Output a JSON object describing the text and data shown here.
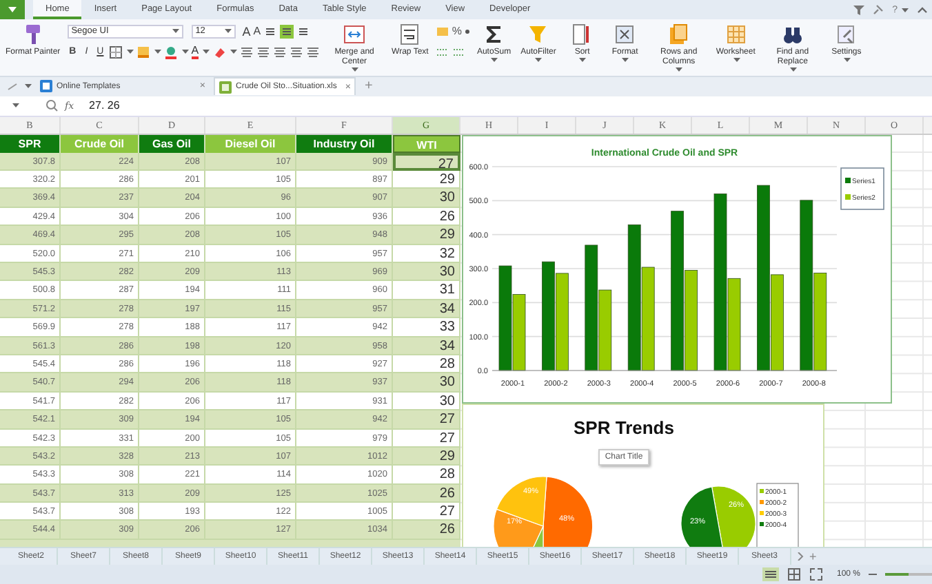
{
  "menu_tabs": [
    {
      "label": "Home",
      "selected": true
    },
    {
      "label": "Insert",
      "selected": false
    },
    {
      "label": "Page Layout",
      "selected": false
    },
    {
      "label": "Formulas",
      "selected": false
    },
    {
      "label": "Data",
      "selected": false
    },
    {
      "label": "Table Style",
      "selected": false
    },
    {
      "label": "Review",
      "selected": false
    },
    {
      "label": "View",
      "selected": false
    },
    {
      "label": "Developer",
      "selected": false
    }
  ],
  "help": "?",
  "ribbon": {
    "format_painter": "Format Painter",
    "font_name": "Segoe UI",
    "font_size": "12",
    "size_keys": [
      "A",
      "A"
    ],
    "style_keys": [
      "B",
      "I",
      "U"
    ],
    "font_color_key": "A",
    "percent": "%",
    "buttons": [
      {
        "label": "Merge and Center",
        "dropdown": true
      },
      {
        "label": "Wrap Text",
        "dropdown": false
      },
      {
        "label": "AutoSum",
        "dropdown": true
      },
      {
        "label": "AutoFilter",
        "dropdown": true
      },
      {
        "label": "Sort",
        "dropdown": true
      },
      {
        "label": "Format",
        "dropdown": true
      },
      {
        "label": "Rows and Columns",
        "dropdown": true
      },
      {
        "label": "Worksheet",
        "dropdown": true
      },
      {
        "label": "Find and Replace",
        "dropdown": true
      },
      {
        "label": "Settings",
        "dropdown": true
      }
    ]
  },
  "doc_tabs": [
    {
      "label": "Online Templates",
      "selected": false,
      "close": "×"
    },
    {
      "label": "Crude Oil Sto...Situation.xls",
      "selected": true,
      "close": "×"
    }
  ],
  "new_tab": "+",
  "formula_bar": {
    "fx": "fx",
    "value": "27. 26"
  },
  "column_letters": [
    {
      "label": "B",
      "selected": false
    },
    {
      "label": "C",
      "selected": false
    },
    {
      "label": "D",
      "selected": false
    },
    {
      "label": "E",
      "selected": false
    },
    {
      "label": "F",
      "selected": false
    },
    {
      "label": "G",
      "selected": true
    },
    {
      "label": "H",
      "selected": false
    },
    {
      "label": "I",
      "selected": false
    },
    {
      "label": "J",
      "selected": false
    },
    {
      "label": "K",
      "selected": false
    },
    {
      "label": "L",
      "selected": false
    },
    {
      "label": "M",
      "selected": false
    },
    {
      "label": "N",
      "selected": false
    },
    {
      "label": "O",
      "selected": false
    }
  ],
  "table": {
    "columns": [
      {
        "label": "SPR",
        "color": "#107c10",
        "selected": false
      },
      {
        "label": "Crude Oil",
        "color": "#8cc63e",
        "selected": false
      },
      {
        "label": "Gas Oil",
        "color": "#107c10",
        "selected": false
      },
      {
        "label": "Diesel Oil",
        "color": "#8cc63e",
        "selected": false
      },
      {
        "label": "Industry Oil",
        "color": "#107c10",
        "selected": false
      },
      {
        "label": "WTI",
        "color": "#8cc63e",
        "selected": true
      }
    ],
    "rows": [
      {
        "selected": true,
        "cells": [
          "307.8",
          "224",
          "208",
          "107",
          "909",
          "27"
        ]
      },
      {
        "selected": false,
        "cells": [
          "320.2",
          "286",
          "201",
          "105",
          "897",
          "29"
        ]
      },
      {
        "selected": false,
        "cells": [
          "369.4",
          "237",
          "204",
          "96",
          "907",
          "30"
        ]
      },
      {
        "selected": false,
        "cells": [
          "429.4",
          "304",
          "206",
          "100",
          "936",
          "26"
        ]
      },
      {
        "selected": false,
        "cells": [
          "469.4",
          "295",
          "208",
          "105",
          "948",
          "29"
        ]
      },
      {
        "selected": false,
        "cells": [
          "520.0",
          "271",
          "210",
          "106",
          "957",
          "32"
        ]
      },
      {
        "selected": false,
        "cells": [
          "545.3",
          "282",
          "209",
          "113",
          "969",
          "30"
        ]
      },
      {
        "selected": false,
        "cells": [
          "500.8",
          "287",
          "194",
          "111",
          "960",
          "31"
        ]
      },
      {
        "selected": false,
        "cells": [
          "571.2",
          "278",
          "197",
          "115",
          "957",
          "34"
        ]
      },
      {
        "selected": false,
        "cells": [
          "569.9",
          "278",
          "188",
          "117",
          "942",
          "33"
        ]
      },
      {
        "selected": false,
        "cells": [
          "561.3",
          "286",
          "198",
          "120",
          "958",
          "34"
        ]
      },
      {
        "selected": false,
        "cells": [
          "545.4",
          "286",
          "196",
          "118",
          "927",
          "28"
        ]
      },
      {
        "selected": false,
        "cells": [
          "540.7",
          "294",
          "206",
          "118",
          "937",
          "30"
        ]
      },
      {
        "selected": false,
        "cells": [
          "541.7",
          "282",
          "206",
          "117",
          "931",
          "30"
        ]
      },
      {
        "selected": false,
        "cells": [
          "542.1",
          "309",
          "194",
          "105",
          "942",
          "27"
        ]
      },
      {
        "selected": false,
        "cells": [
          "542.3",
          "331",
          "200",
          "105",
          "979",
          "27"
        ]
      },
      {
        "selected": false,
        "cells": [
          "543.2",
          "328",
          "213",
          "107",
          "1012",
          "29"
        ]
      },
      {
        "selected": false,
        "cells": [
          "543.3",
          "308",
          "221",
          "114",
          "1020",
          "28"
        ]
      },
      {
        "selected": false,
        "cells": [
          "543.7",
          "313",
          "209",
          "125",
          "1025",
          "26"
        ]
      },
      {
        "selected": false,
        "cells": [
          "543.7",
          "308",
          "193",
          "122",
          "1005",
          "27"
        ]
      },
      {
        "selected": false,
        "cells": [
          "544.4",
          "309",
          "206",
          "127",
          "1034",
          "26"
        ]
      }
    ]
  },
  "bar_chart": {
    "chart_data": {
      "type": "bar",
      "title": "International Crude Oil and SPR",
      "categories": [
        "2000-1",
        "2000-2",
        "2000-3",
        "2000-4",
        "2000-5",
        "2000-6",
        "2000-7",
        "2000-8"
      ],
      "series": [
        {
          "name": "Series1",
          "color": "#0a7a0a",
          "values": [
            308,
            320,
            369,
            429,
            469,
            520,
            545,
            501
          ]
        },
        {
          "name": "Series2",
          "color": "#99cc00",
          "values": [
            224,
            286,
            237,
            304,
            295,
            271,
            282,
            287
          ]
        }
      ],
      "ylim": [
        0,
        600
      ],
      "grid": true,
      "legend": true,
      "yticks": [
        {
          "value": 0,
          "label": "0.0"
        },
        {
          "value": 100,
          "label": "100.0"
        },
        {
          "value": 200,
          "label": "200.0"
        },
        {
          "value": 300,
          "label": "300.0"
        },
        {
          "value": 400,
          "label": "400.0"
        },
        {
          "value": 500,
          "label": "500.0"
        },
        {
          "value": 600,
          "label": "600.0"
        }
      ]
    }
  },
  "pie_panel": {
    "title": "SPR Trends",
    "chart_title": "Chart Title",
    "pies": [
      {
        "labels": [
          "49%",
          "48%",
          "17%"
        ]
      },
      {
        "labels": [
          "23%",
          "26%"
        ]
      }
    ],
    "legend": [
      {
        "label": "2000-1",
        "color": "#99cc00"
      },
      {
        "label": "2000-2",
        "color": "#ff9900"
      },
      {
        "label": "2000-3",
        "color": "#ffcc00"
      },
      {
        "label": "2000-4",
        "color": "#107c10"
      }
    ]
  },
  "sheet_tabs": [
    {
      "label": "Sheet2",
      "selected": false
    },
    {
      "label": "Sheet7",
      "selected": false
    },
    {
      "label": "Sheet8",
      "selected": false
    },
    {
      "label": "Sheet9",
      "selected": false
    },
    {
      "label": "Sheet10",
      "selected": false
    },
    {
      "label": "Sheet11",
      "selected": false
    },
    {
      "label": "Sheet12",
      "selected": false
    },
    {
      "label": "Sheet13",
      "selected": false
    },
    {
      "label": "Sheet14",
      "selected": false
    },
    {
      "label": "Sheet15",
      "selected": false
    },
    {
      "label": "Sheet16",
      "selected": false
    },
    {
      "label": "Sheet17",
      "selected": false
    },
    {
      "label": "Sheet18",
      "selected": false
    },
    {
      "label": "Sheet19",
      "selected": false
    },
    {
      "label": "Sheet3",
      "selected": false
    }
  ],
  "add_sheet": "+",
  "zoom": {
    "label": "100 %",
    "level": 0.5
  }
}
